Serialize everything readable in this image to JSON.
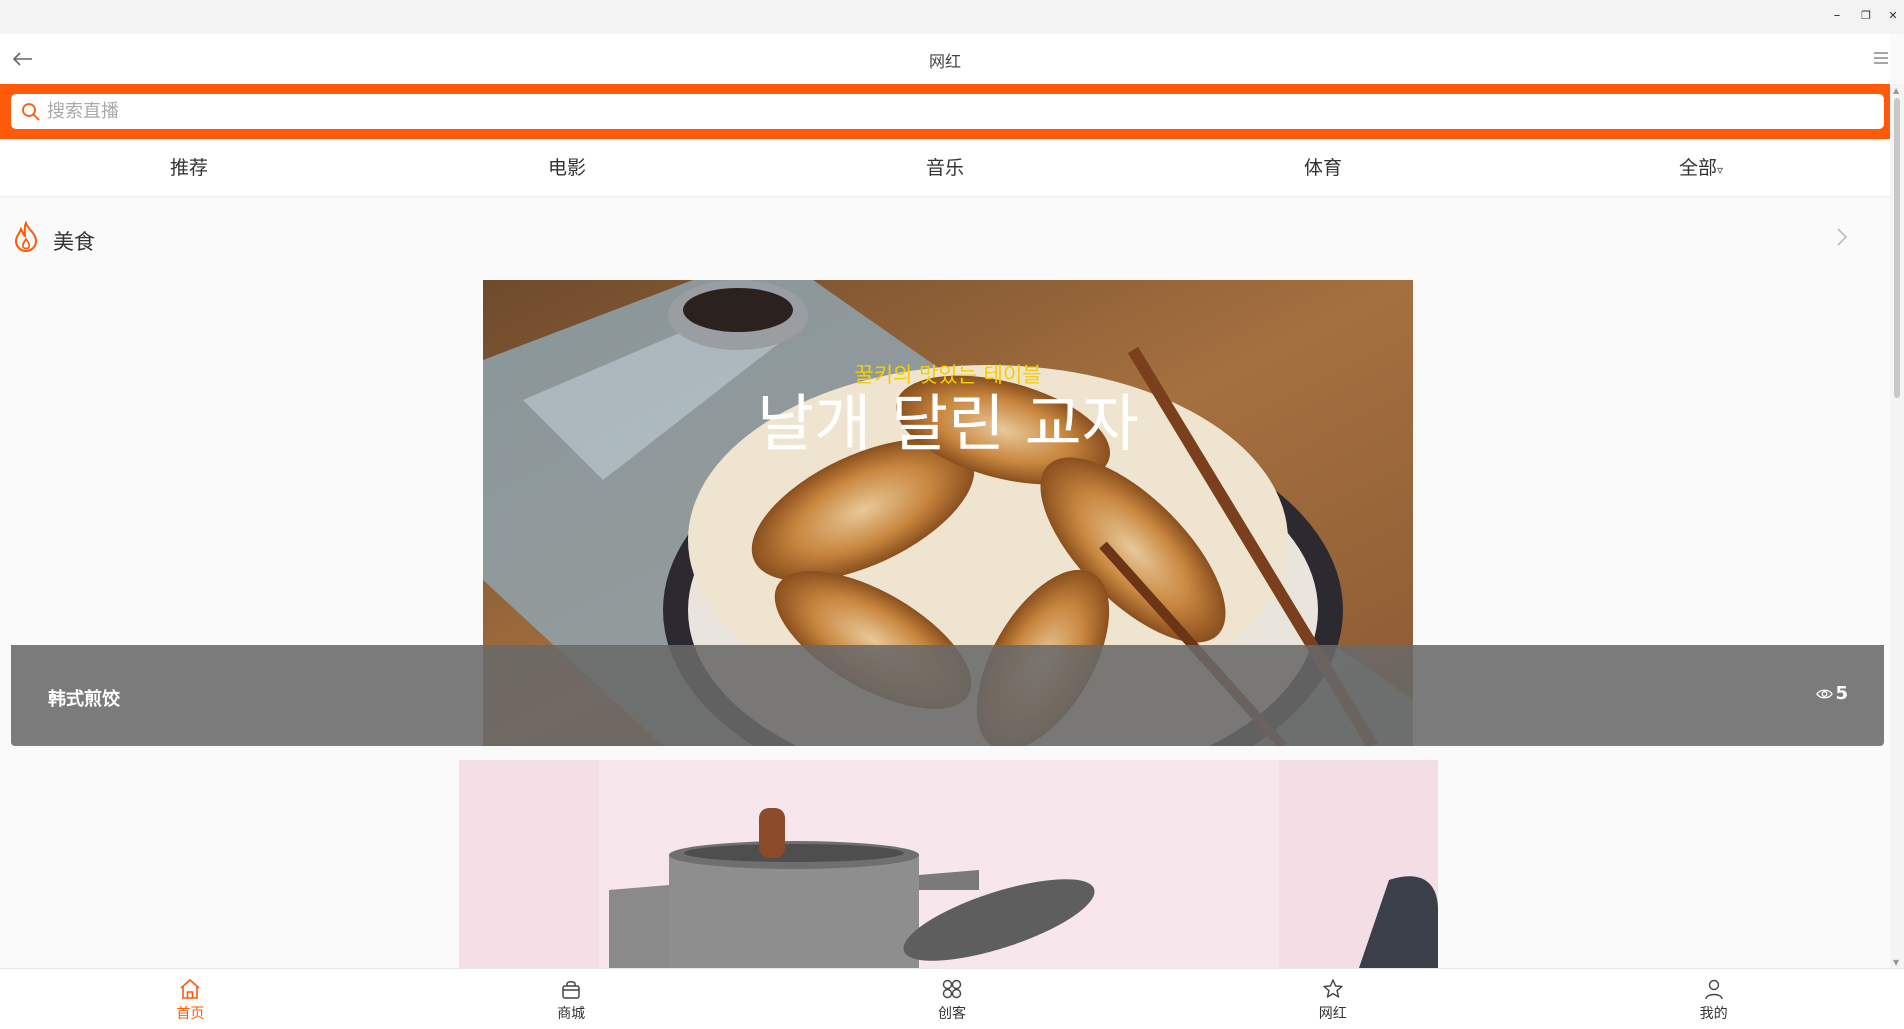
{
  "window": {
    "minimize": "–",
    "restore": "❐",
    "close": "✕"
  },
  "header": {
    "title": "网红",
    "back_icon": "back-arrow-icon",
    "menu_icon": "hamburger-menu-icon"
  },
  "search": {
    "placeholder": "搜索直播",
    "value": ""
  },
  "tabs": [
    {
      "label": "推荐"
    },
    {
      "label": "电影"
    },
    {
      "label": "音乐"
    },
    {
      "label": "体育"
    },
    {
      "label": "全部",
      "caret": "▿"
    }
  ],
  "section": {
    "title": "美食",
    "icon": "fire-icon",
    "more_icon": "chevron-right-icon"
  },
  "cards": [
    {
      "title": "韩式煎饺",
      "views": "5",
      "image_caption_small": "꿀키의 맛있는 테이블",
      "image_caption_large": "날개 달린 교자"
    },
    {
      "title": ""
    }
  ],
  "bottom_nav": [
    {
      "label": "首页",
      "icon": "home-icon",
      "active": true
    },
    {
      "label": "商城",
      "icon": "shopping-bag-icon",
      "active": false
    },
    {
      "label": "创客",
      "icon": "grid-apps-icon",
      "active": false
    },
    {
      "label": "网红",
      "icon": "star-icon",
      "active": false
    },
    {
      "label": "我的",
      "icon": "user-icon",
      "active": false
    }
  ],
  "colors": {
    "accent": "#ff5a0a",
    "overlay": "#696969"
  }
}
